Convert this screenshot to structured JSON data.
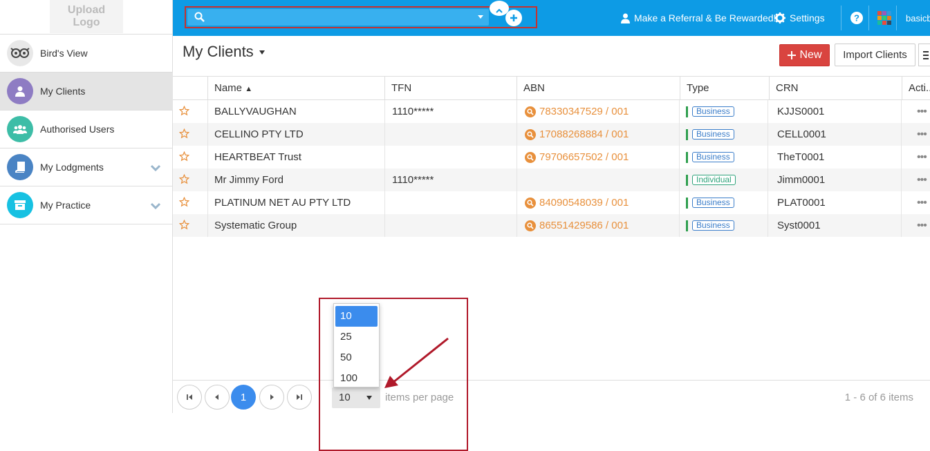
{
  "logo": {
    "line1": "Upload",
    "line2": "Logo"
  },
  "sidebar": {
    "items": [
      {
        "label": "Bird's View",
        "icon": "owl-icon",
        "color": "#555555",
        "active": false,
        "chevron": false
      },
      {
        "label": "My Clients",
        "icon": "user-icon",
        "color": "#8e7cc3",
        "active": true,
        "chevron": false
      },
      {
        "label": "Authorised Users",
        "icon": "users-icon",
        "color": "#3dbda7",
        "active": false,
        "chevron": false
      },
      {
        "label": "My Lodgments",
        "icon": "book-icon",
        "color": "#4a84c4",
        "active": false,
        "chevron": true
      },
      {
        "label": "My Practice",
        "icon": "archive-icon",
        "color": "#17c1e2",
        "active": false,
        "chevron": true
      }
    ]
  },
  "topbar": {
    "search_value": "",
    "referral_label": "Make a Referral & Be Rewarded!",
    "settings_label": "Settings",
    "user_label": "basicb"
  },
  "page": {
    "title": "My Clients",
    "new_label": "New",
    "import_label": "Import Clients"
  },
  "grid": {
    "columns": [
      "Name",
      "TFN",
      "ABN",
      "Type",
      "CRN",
      "Acti..."
    ],
    "sort_indicator": "▲",
    "rows": [
      {
        "name": "BALLYVAUGHAN",
        "tfn": "1110*****",
        "abn": "78330347529 / 001",
        "type": "Business",
        "crn": "KJJS0001"
      },
      {
        "name": "CELLINO PTY LTD",
        "tfn": "",
        "abn": "17088268884 / 001",
        "type": "Business",
        "crn": "CELL0001"
      },
      {
        "name": "HEARTBEAT Trust",
        "tfn": "",
        "abn": "79706657502 / 001",
        "type": "Business",
        "crn": "TheT0001"
      },
      {
        "name": "Mr Jimmy Ford",
        "tfn": "1110*****",
        "abn": "",
        "type": "Individual",
        "crn": "Jimm0001"
      },
      {
        "name": "PLATINUM NET AU PTY LTD",
        "tfn": "",
        "abn": "84090548039 / 001",
        "type": "Business",
        "crn": "PLAT0001"
      },
      {
        "name": "Systematic Group",
        "tfn": "",
        "abn": "86551429586 / 001",
        "type": "Business",
        "crn": "Syst0001"
      }
    ],
    "row_action": "•••"
  },
  "pager": {
    "current_page": "1",
    "page_size": "10",
    "items_per_page_label": "items per page",
    "info": "1 - 6 of 6 items",
    "options": [
      "10",
      "25",
      "50",
      "100"
    ]
  },
  "colors": {
    "topbar": "#0d9be5",
    "accent": "#3b8ced",
    "new_button": "#d9443f",
    "abn_link": "#e8903c",
    "highlight": "#b0192a"
  }
}
